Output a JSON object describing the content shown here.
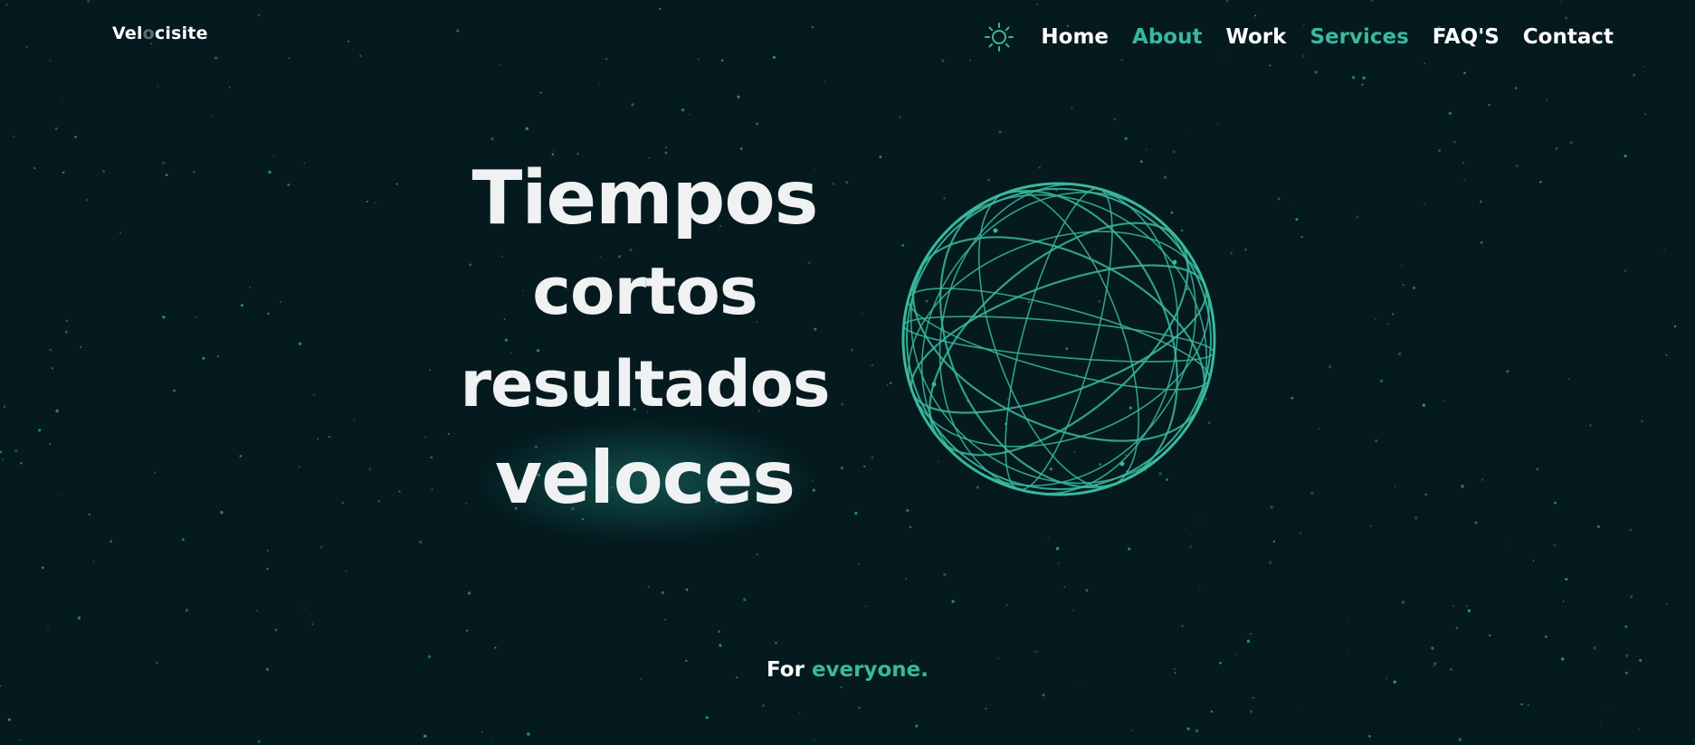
{
  "brand": {
    "logo_start": "Vel",
    "logo_dim": "o",
    "logo_end": "cisite"
  },
  "nav": {
    "theme_icon": "sun-icon",
    "items": [
      {
        "label": "Home",
        "accent": false
      },
      {
        "label": "About",
        "accent": true
      },
      {
        "label": "Work",
        "accent": false
      },
      {
        "label": "Services",
        "accent": true
      },
      {
        "label": "FAQ'S",
        "accent": false
      },
      {
        "label": "Contact",
        "accent": false
      }
    ]
  },
  "hero": {
    "line1": "Tiempos",
    "line2": "cortos",
    "line3": "resultados",
    "line4": "veloces"
  },
  "tagline": {
    "prefix": "For",
    "highlight": "everyone."
  },
  "colors": {
    "background": "#041a1f",
    "accent": "#39b89c",
    "text": "#eff1f2"
  }
}
